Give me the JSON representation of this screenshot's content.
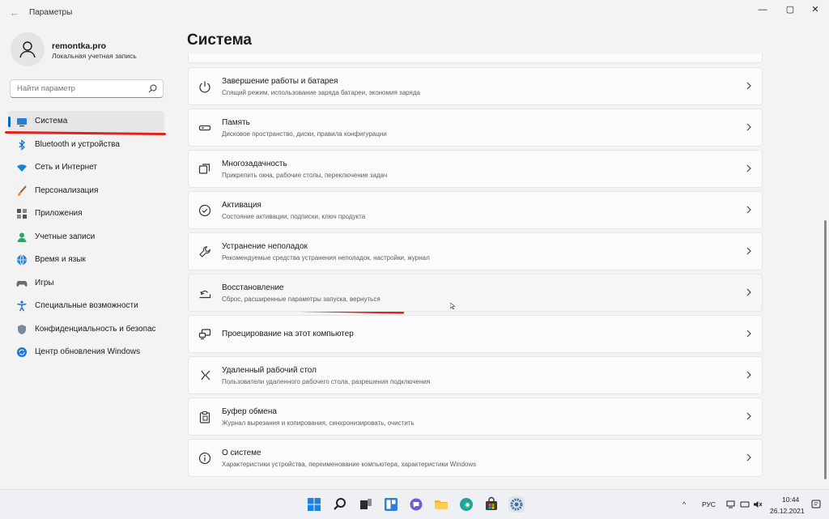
{
  "window": {
    "title": "Параметры",
    "back": "←",
    "minimize": "—",
    "maximize": "▢",
    "close": "✕"
  },
  "user": {
    "name": "remontka.pro",
    "account_type": "Локальная учетная запись"
  },
  "search": {
    "placeholder": "Найти параметр"
  },
  "sidebar": {
    "items": [
      {
        "label": "Система",
        "icon": "monitor-icon",
        "active": true
      },
      {
        "label": "Bluetooth и устройства",
        "icon": "bluetooth-icon"
      },
      {
        "label": "Сеть и Интернет",
        "icon": "wifi-icon"
      },
      {
        "label": "Персонализация",
        "icon": "brush-icon"
      },
      {
        "label": "Приложения",
        "icon": "apps-icon"
      },
      {
        "label": "Учетные записи",
        "icon": "person-icon"
      },
      {
        "label": "Время и язык",
        "icon": "globe-icon"
      },
      {
        "label": "Игры",
        "icon": "gamepad-icon"
      },
      {
        "label": "Специальные возможности",
        "icon": "accessibility-icon"
      },
      {
        "label": "Конфиденциальность и безопас",
        "icon": "shield-icon"
      },
      {
        "label": "Центр обновления Windows",
        "icon": "update-icon"
      }
    ]
  },
  "main": {
    "title": "Система",
    "cards": [
      {
        "title": "Завершение работы и батарея",
        "subtitle": "Спящий режим, использование заряда батареи, экономия заряда",
        "icon": "power-icon"
      },
      {
        "title": "Память",
        "subtitle": "Дисковое пространство, диски, правила конфигурации",
        "icon": "storage-icon"
      },
      {
        "title": "Многозадачность",
        "subtitle": "Прикрепить окна, рабочие столы, переключение задач",
        "icon": "multitasking-icon"
      },
      {
        "title": "Активация",
        "subtitle": "Состояние активации, подписки, ключ продукта",
        "icon": "activation-check-icon"
      },
      {
        "title": "Устранение неполадок",
        "subtitle": "Рекомендуемые средства устранения неполадок, настройки, журнал",
        "icon": "wrench-icon"
      },
      {
        "title": "Восстановление",
        "subtitle": "Сброс, расширенные параметры запуска, вернуться",
        "icon": "recovery-icon"
      },
      {
        "title": "Проецирование на этот компьютер",
        "subtitle": "",
        "icon": "projection-icon"
      },
      {
        "title": "Удаленный рабочий стол",
        "subtitle": "Пользователи удаленного рабочего стола, разрешения подключения",
        "icon": "remote-desktop-icon"
      },
      {
        "title": "Буфер обмена",
        "subtitle": "Журнал вырезания и копирования, синхронизировать, очистить",
        "icon": "clipboard-icon"
      },
      {
        "title": "О системе",
        "subtitle": "Характеристики устройства, переименование компьютера, характеристики Windows",
        "icon": "info-icon"
      }
    ]
  },
  "taskbar": {
    "tray_chevron": "^",
    "language": "РУС",
    "time": "10:44",
    "date": "26.12.2021"
  },
  "colors": {
    "accent": "#0067c0",
    "annotation": "#e0221b"
  }
}
